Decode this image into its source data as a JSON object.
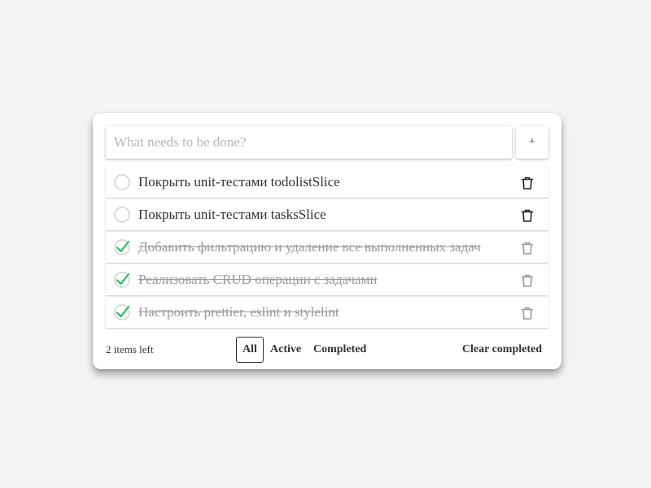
{
  "input": {
    "placeholder": "What needs to be done?",
    "value": "",
    "add_label": "+"
  },
  "todos": [
    {
      "text": "Покрыть unit-тестами todolistSlice",
      "completed": false,
      "delete_icon": "trash-icon"
    },
    {
      "text": "Покрыть unit-тестами tasksSlice",
      "completed": false,
      "delete_icon": "trash-icon"
    },
    {
      "text": "Добавить фильтрацию и удаление все выполненных задач",
      "completed": true,
      "delete_icon": "trash-icon"
    },
    {
      "text": "Реализовать CRUD операции с задачами",
      "completed": true,
      "delete_icon": "trash-icon"
    },
    {
      "text": "Настроить prettier, eslint и stylelint",
      "completed": true,
      "delete_icon": "trash-icon"
    }
  ],
  "footer": {
    "items_left": "2 items left",
    "filters": [
      {
        "label": "All",
        "active": true
      },
      {
        "label": "Active",
        "active": false
      },
      {
        "label": "Completed",
        "active": false
      }
    ],
    "clear_label": "Clear completed"
  },
  "colors": {
    "check_green": "#26c15a",
    "circle_gray": "#cfcfcf",
    "page_background": "#f4f4f4"
  }
}
